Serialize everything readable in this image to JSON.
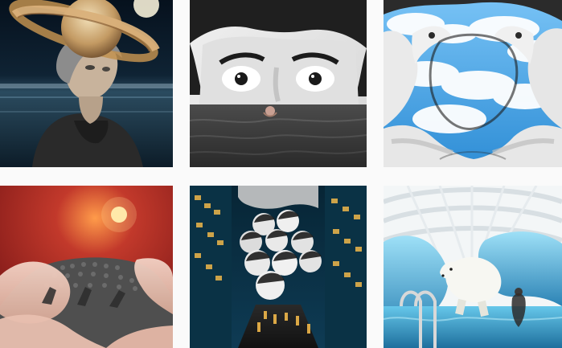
{
  "gallery": {
    "tiles": [
      {
        "subject": "woman-with-saturn-hat",
        "palette": [
          "#0b1a2a",
          "#2e4a5e",
          "#c9a46b"
        ]
      },
      {
        "subject": "surreal-eyes-over-sea",
        "palette": [
          "#d9d9d9",
          "#3b3b3b",
          "#6b6b6b"
        ]
      },
      {
        "subject": "woman-with-sky-face",
        "palette": [
          "#5aa7e6",
          "#ffffff",
          "#2a2a2a"
        ]
      },
      {
        "subject": "red-sky-crowd-on-sheets",
        "palette": [
          "#b3322a",
          "#efc7b9",
          "#5f5f5f"
        ]
      },
      {
        "subject": "children-over-city-street",
        "palette": [
          "#0a2a3a",
          "#f0b74a",
          "#bfbfbf"
        ]
      },
      {
        "subject": "polar-bear-on-ice-indoors",
        "palette": [
          "#7fd0ef",
          "#f4f4f4",
          "#1d5f86"
        ]
      }
    ]
  }
}
